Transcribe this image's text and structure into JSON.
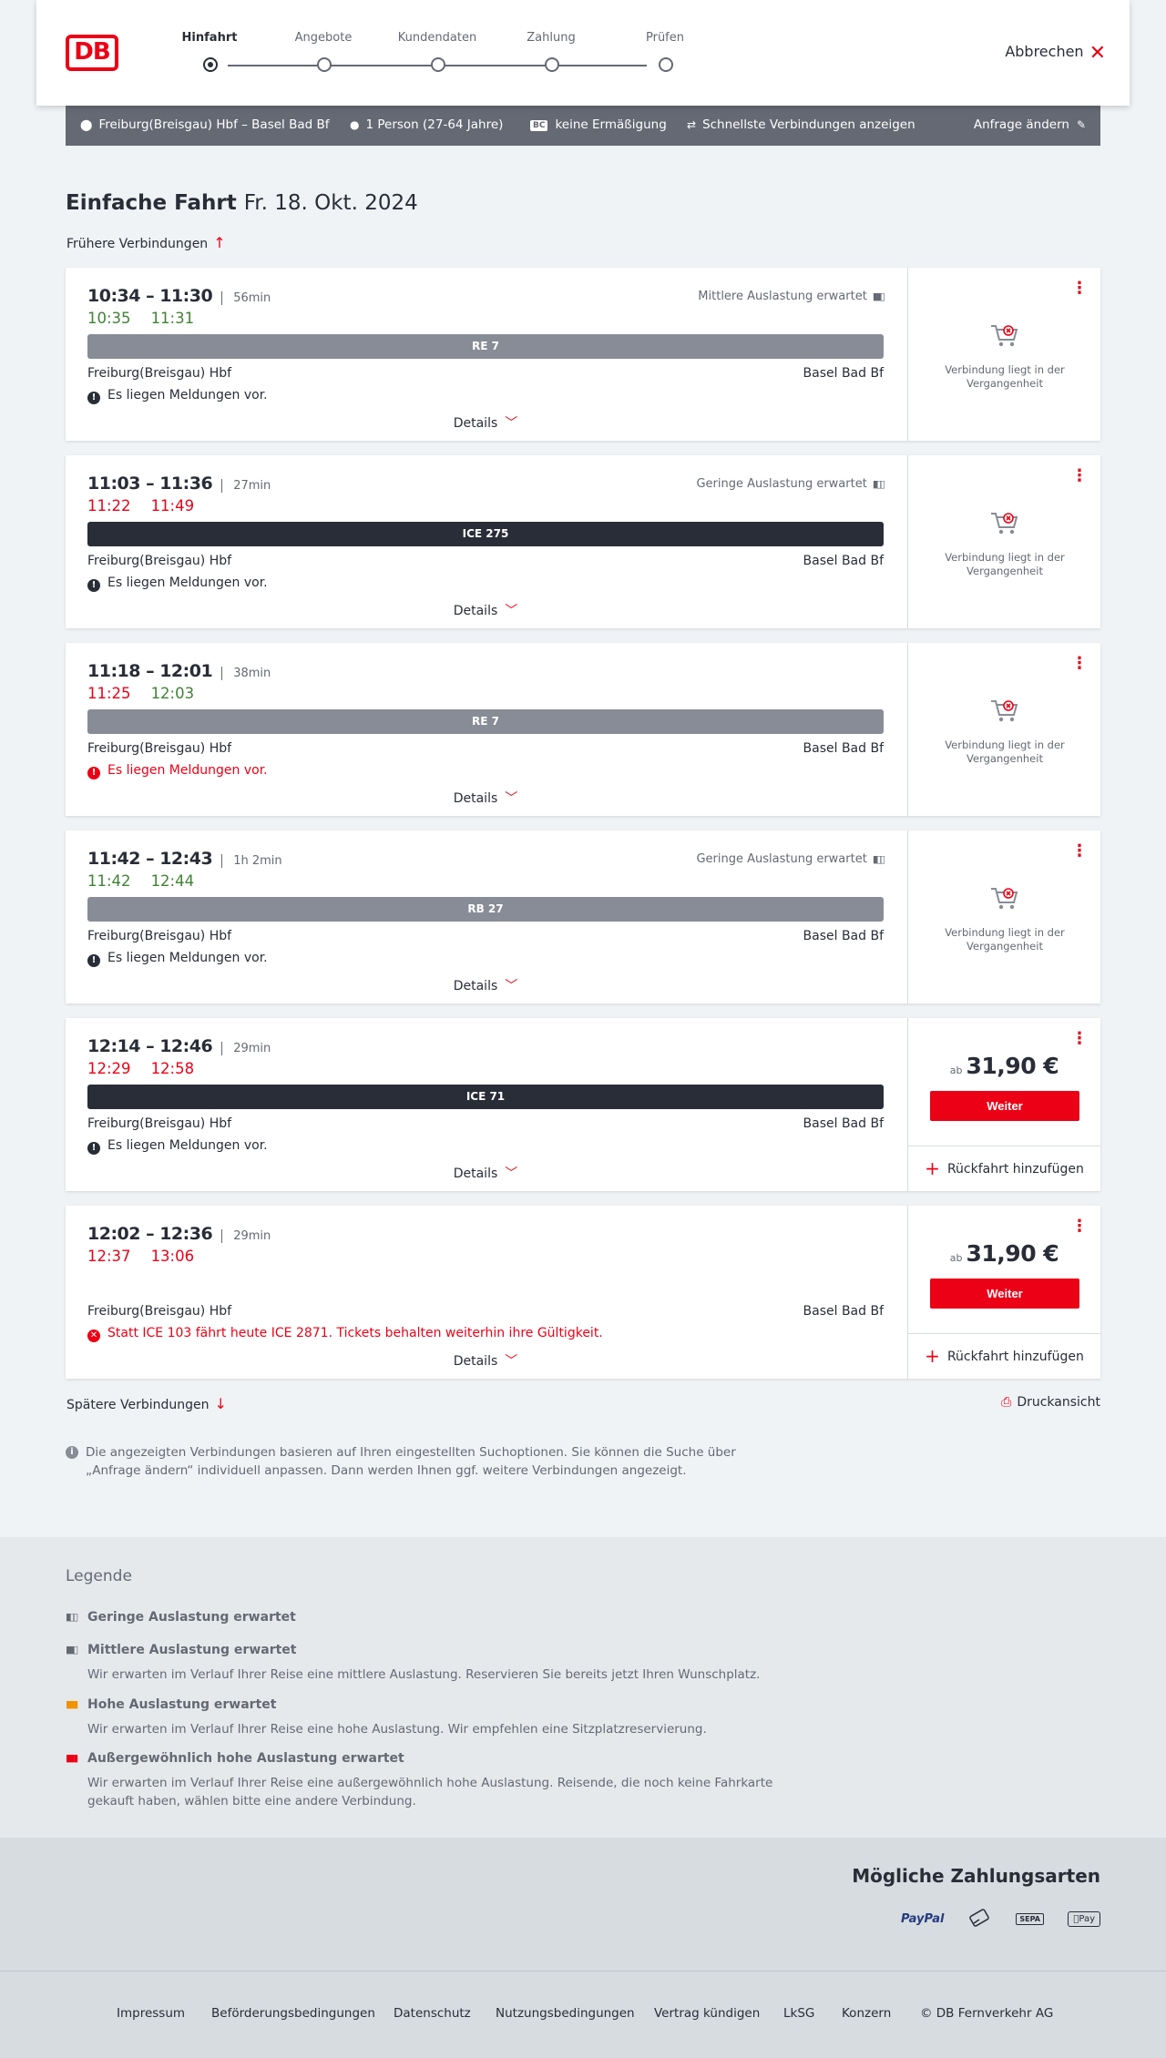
{
  "header": {
    "logo_text": "DB",
    "steps": [
      "Hinfahrt",
      "Angebote",
      "Kundendaten",
      "Zahlung",
      "Prüfen"
    ],
    "active_step": 0,
    "cancel_label": "Abbrechen"
  },
  "search": {
    "route": "Freiburg(Breisgau) Hbf – Basel Bad Bf",
    "travellers": "1 Person (27-64 Jahre)",
    "bc_badge": "BC",
    "discount": "keine Ermäßigung",
    "fastest": "Schnellste Verbindungen anzeigen",
    "change": "Anfrage ändern"
  },
  "page": {
    "title": "Einfache Fahrt",
    "date": "Fr. 18. Okt. 2024",
    "earlier": "Frühere Verbindungen",
    "later": "Spätere Verbindungen",
    "print": "Druckansicht",
    "info": "Die angezeigten Verbindungen basieren auf Ihren eingestellten Suchoptionen. Sie können die Suche über „Anfrage ändern“ individuell anpassen. Dann werden Ihnen ggf. weitere Verbindungen angezeigt."
  },
  "common": {
    "details": "Details",
    "past_text": "Verbindung liegt in der Vergangenheit",
    "price_prefix": "ab",
    "continue": "Weiter",
    "return_trip": "Rückfahrt hinzufügen"
  },
  "connections": [
    {
      "times": "10:34 – 11:30",
      "duration": "56min",
      "rt_dep": "10:35",
      "rt_dep_color": "green",
      "rt_arr": "11:31",
      "rt_arr_color": "green",
      "occupancy": "Mittlere Auslastung erwartet",
      "train": "RE 7",
      "train_style": "grey",
      "from": "Freiburg(Breisgau) Hbf",
      "to": "Basel Bad Bf",
      "message": "Es liegen Meldungen vor.",
      "message_type": "info",
      "state": "past"
    },
    {
      "times": "11:03 – 11:36",
      "duration": "27min",
      "rt_dep": "11:22",
      "rt_dep_color": "red",
      "rt_arr": "11:49",
      "rt_arr_color": "red",
      "occupancy": "Geringe Auslastung erwartet",
      "train": "ICE 275",
      "train_style": "dark",
      "from": "Freiburg(Breisgau) Hbf",
      "to": "Basel Bad Bf",
      "message": "Es liegen Meldungen vor.",
      "message_type": "info",
      "state": "past"
    },
    {
      "times": "11:18 – 12:01",
      "duration": "38min",
      "rt_dep": "11:25",
      "rt_dep_color": "red",
      "rt_arr": "12:03",
      "rt_arr_color": "green",
      "occupancy": "",
      "train": "RE 7",
      "train_style": "grey",
      "from": "Freiburg(Breisgau) Hbf",
      "to": "Basel Bad Bf",
      "message": "Es liegen Meldungen vor.",
      "message_type": "warning",
      "state": "past"
    },
    {
      "times": "11:42 – 12:43",
      "duration": "1h 2min",
      "rt_dep": "11:42",
      "rt_dep_color": "green",
      "rt_arr": "12:44",
      "rt_arr_color": "green",
      "occupancy": "Geringe Auslastung erwartet",
      "train": "RB 27",
      "train_style": "grey",
      "from": "Freiburg(Breisgau) Hbf",
      "to": "Basel Bad Bf",
      "message": "Es liegen Meldungen vor.",
      "message_type": "info",
      "state": "past"
    },
    {
      "times": "12:14 – 12:46",
      "duration": "29min",
      "rt_dep": "12:29",
      "rt_dep_color": "red",
      "rt_arr": "12:58",
      "rt_arr_color": "red",
      "occupancy": "",
      "train": "ICE 71",
      "train_style": "dark",
      "from": "Freiburg(Breisgau) Hbf",
      "to": "Basel Bad Bf",
      "message": "Es liegen Meldungen vor.",
      "message_type": "info",
      "state": "bookable",
      "price": "31,90 €"
    },
    {
      "times": "12:02 – 12:36",
      "duration": "29min",
      "rt_dep": "12:37",
      "rt_dep_color": "red",
      "rt_arr": "13:06",
      "rt_arr_color": "red",
      "occupancy": "",
      "train": "",
      "train_style": "none",
      "from": "Freiburg(Breisgau) Hbf",
      "to": "Basel Bad Bf",
      "message": "Statt ICE 103 fährt heute ICE 2871. Tickets behalten weiterhin ihre Gültigkeit.",
      "message_type": "cancel",
      "state": "bookable",
      "price": "31,90 €"
    }
  ],
  "legend": {
    "title": "Legende",
    "items": [
      {
        "title": "Geringe Auslastung erwartet",
        "desc": "",
        "level": 1
      },
      {
        "title": "Mittlere Auslastung erwartet",
        "desc": "Wir erwarten im Verlauf Ihrer Reise eine mittlere Auslastung. Reservieren Sie bereits jetzt Ihren Wunschplatz.",
        "level": 2
      },
      {
        "title": "Hohe Auslastung erwartet",
        "desc": "Wir erwarten im Verlauf Ihrer Reise eine hohe Auslastung. Wir empfehlen eine Sitzplatzreservierung.",
        "level": 3
      },
      {
        "title": "Außergewöhnlich hohe Auslastung erwartet",
        "desc": "Wir erwarten im Verlauf Ihrer Reise eine außergewöhnlich hohe Auslastung. Reisende, die noch keine Fahrkarte gekauft haben, wählen bitte eine andere Verbindung.",
        "level": 4
      }
    ]
  },
  "payment": {
    "title": "Mögliche Zahlungsarten",
    "methods": [
      {
        "icon": "paypal-icon",
        "label": "PayPal"
      },
      {
        "icon": "credit-card-icon",
        "label": ""
      },
      {
        "icon": "sepa-icon",
        "label": "SEPA"
      },
      {
        "icon": "apple-pay-icon",
        "label": "Pay"
      }
    ]
  },
  "footer": {
    "links": [
      "Impressum",
      "Beförderungsbedingungen",
      "Datenschutz",
      "Nutzungsbedingungen",
      "Vertrag kündigen",
      "LkSG",
      "Konzern",
      "© DB Fernverkehr AG"
    ]
  },
  "colors": {
    "accent": "#ec0016",
    "dark": "#282d37",
    "grey": "#646973",
    "green": "#408335"
  }
}
